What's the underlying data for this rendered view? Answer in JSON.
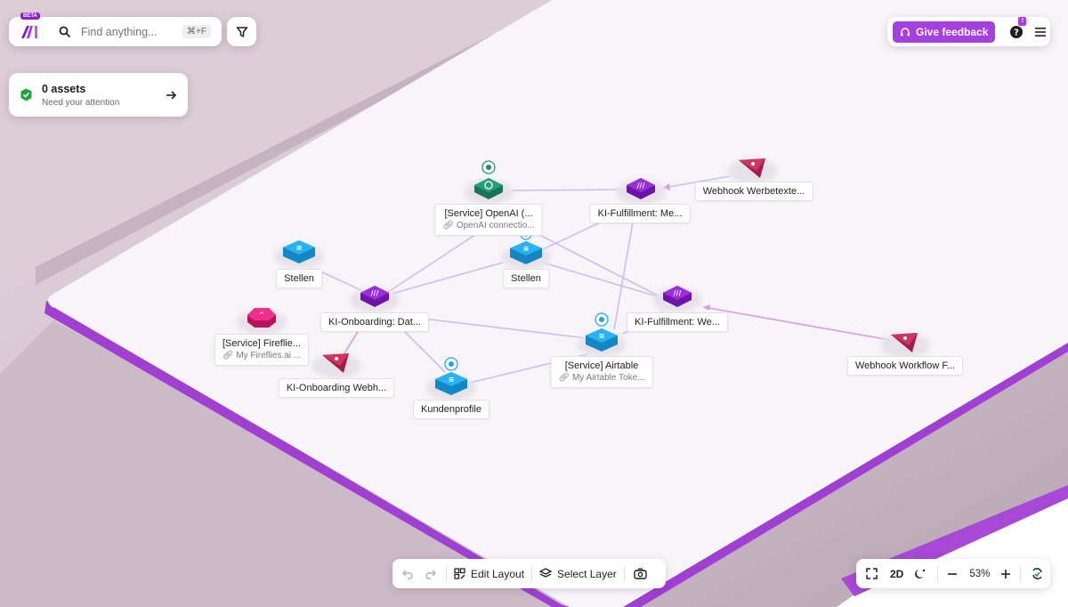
{
  "brand": {
    "beta_badge": "BETA"
  },
  "search": {
    "placeholder": "Find anything...",
    "shortcut": "⌘+F"
  },
  "assets_card": {
    "title": "0 assets",
    "subtitle": "Need your attention"
  },
  "header": {
    "feedback_label": "Give feedback",
    "help_badge": "!"
  },
  "nodes": {
    "openai": {
      "label": "[Service] OpenAI (...",
      "sub": "OpenAI connectio..."
    },
    "ki_fulfillment_me": {
      "label": "KI-Fulfillment: Me..."
    },
    "webhook_werbetexte": {
      "label": "Webhook Werbetexte..."
    },
    "stellen_left": {
      "label": "Stellen"
    },
    "stellen_center": {
      "label": "Stellen"
    },
    "ki_onboarding_dat": {
      "label": "KI-Onboarding: Dat..."
    },
    "ki_fulfillment_we": {
      "label": "KI-Fulfillment: We..."
    },
    "fireflies": {
      "label": "[Service] Fireflie...",
      "sub": "My Fireflies.ai ..."
    },
    "airtable": {
      "label": "[Service] Airtable",
      "sub": "My Airtable Toke..."
    },
    "webhook_workflow": {
      "label": "Webhook Workflow F..."
    },
    "ki_onboarding_webh": {
      "label": "KI-Onboarding Webh..."
    },
    "kundenprofile": {
      "label": "Kundenprofile"
    }
  },
  "toolbar": {
    "edit_layout": "Edit Layout",
    "select_layer": "Select Layer"
  },
  "view_controls": {
    "mode": "2D",
    "zoom": "53%"
  },
  "colors": {
    "accent": "#a63fe0",
    "make_purple": "#8b20c9",
    "airtable_blue": "#1ea7e6",
    "openai_green": "#1f8f6b",
    "webhook_red": "#c02e57",
    "fireflies_pink": "#e6197c",
    "edge": "#c9b7f3",
    "success": "#20a33b"
  },
  "icons": [
    "make-logo-icon",
    "search-icon",
    "filter-icon",
    "check-circle-icon",
    "arrow-right-icon",
    "headset-icon",
    "help-icon",
    "menu-icon",
    "undo-icon",
    "redo-icon",
    "edit-layout-icon",
    "layers-icon",
    "camera-icon",
    "expand-icon",
    "moon-icon",
    "zoom-out-icon",
    "zoom-in-icon",
    "sync-icon"
  ]
}
